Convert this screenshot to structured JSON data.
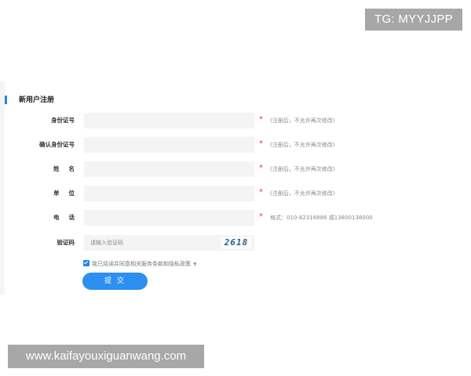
{
  "watermarks": {
    "tg": "TG: MYYJJPP",
    "site": "www.kaifayouxiguanwang.com"
  },
  "form": {
    "title": "新用户注册",
    "fields": [
      {
        "label": "身份证号",
        "value": "",
        "placeholder": "",
        "required": "*",
        "hint": "(注册后，不允许再次修改)"
      },
      {
        "label": "确认身份证号",
        "value": "",
        "placeholder": "",
        "required": "*",
        "hint": "(注册后，不允许再次修改)"
      },
      {
        "label": "姓名",
        "value": "",
        "placeholder": "",
        "required": "*",
        "hint": "(注册后，不允许再次修改)"
      },
      {
        "label": "单位",
        "value": "",
        "placeholder": "",
        "required": "*",
        "hint": "(注册后，不允许再次修改)"
      },
      {
        "label": "电话",
        "value": "",
        "placeholder": "",
        "required": "*",
        "hint": "格式：010-82316888 或13800138000"
      }
    ],
    "captcha": {
      "label": "验证码",
      "placeholder": "请输入验证码",
      "code": "2618"
    },
    "agreement": {
      "checked": true,
      "text": "我已阅读并同意相关服务条款和隐私政策",
      "caret": "▼"
    },
    "submit_label": "提 交"
  },
  "colors": {
    "accent": "#2d8ff0",
    "required": "#e53935",
    "input_bg": "#f4f4f4"
  }
}
